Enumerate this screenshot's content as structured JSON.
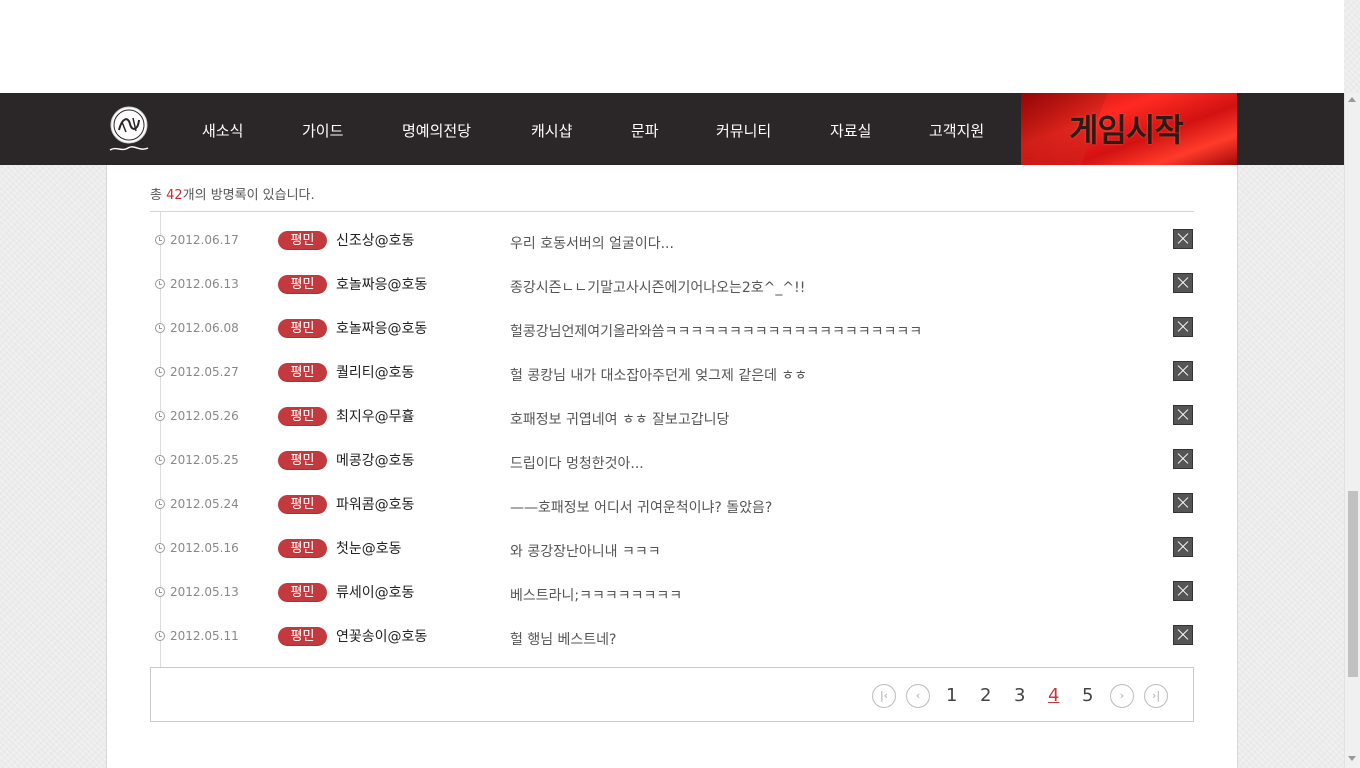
{
  "nav": {
    "items": [
      "새소식",
      "가이드",
      "명예의전당",
      "캐시샵",
      "문파",
      "커뮤니티",
      "자료실",
      "고객지원"
    ],
    "game_start": "게임시작"
  },
  "guestbook": {
    "total_prefix": "총 ",
    "total_count": "42",
    "total_suffix": "개의 방명록이 있습니다.",
    "entries": [
      {
        "date": "2012.06.17",
        "rank": "평민",
        "author": "신조상@호동",
        "message": "우리 호동서버의 얼굴이다..."
      },
      {
        "date": "2012.06.13",
        "rank": "평민",
        "author": "호놀짜응@호동",
        "message": "종강시즌ㄴㄴ기말고사시즌에기어나오는2호^_^!!"
      },
      {
        "date": "2012.06.08",
        "rank": "평민",
        "author": "호놀짜응@호동",
        "message": "헐콩강님언제여기올라와씀ㅋㅋㅋㅋㅋㅋㅋㅋㅋㅋㅋㅋㅋㅋㅋㅋㅋㅋㅋㅋ"
      },
      {
        "date": "2012.05.27",
        "rank": "평민",
        "author": "퀄리티@호동",
        "message": "헐 콩캉님 내가 대소잡아주던게 엊그제 같은데 ㅎㅎ"
      },
      {
        "date": "2012.05.26",
        "rank": "평민",
        "author": "최지우@무휼",
        "message": "호패정보 귀엽네여 ㅎㅎ 잘보고갑니당"
      },
      {
        "date": "2012.05.25",
        "rank": "평민",
        "author": "메콩강@호동",
        "message": "드립이다 멍청한것아..."
      },
      {
        "date": "2012.05.24",
        "rank": "평민",
        "author": "파워콤@호동",
        "message": "——호패정보 어디서 귀여운척이냐? 돌았음?"
      },
      {
        "date": "2012.05.16",
        "rank": "평민",
        "author": "첫눈@호동",
        "message": "와 콩강장난아니내 ㅋㅋㅋ"
      },
      {
        "date": "2012.05.13",
        "rank": "평민",
        "author": "류세이@호동",
        "message": "베스트라니;ㅋㅋㅋㅋㅋㅋㅋㅋ"
      },
      {
        "date": "2012.05.11",
        "rank": "평민",
        "author": "연꽃송이@호동",
        "message": "헐 행님 베스트네?"
      }
    ]
  },
  "pagination": {
    "pages": [
      "1",
      "2",
      "3",
      "4",
      "5"
    ],
    "current": "4",
    "first_icon": "first-page-icon",
    "prev_icon": "prev-page-icon",
    "next_icon": "next-page-icon",
    "last_icon": "last-page-icon"
  },
  "colors": {
    "nav_bg": "#2b2627",
    "rank_badge": "#c3393d",
    "count_highlight": "#d4262a",
    "game_start_bg": "#e8201c"
  }
}
